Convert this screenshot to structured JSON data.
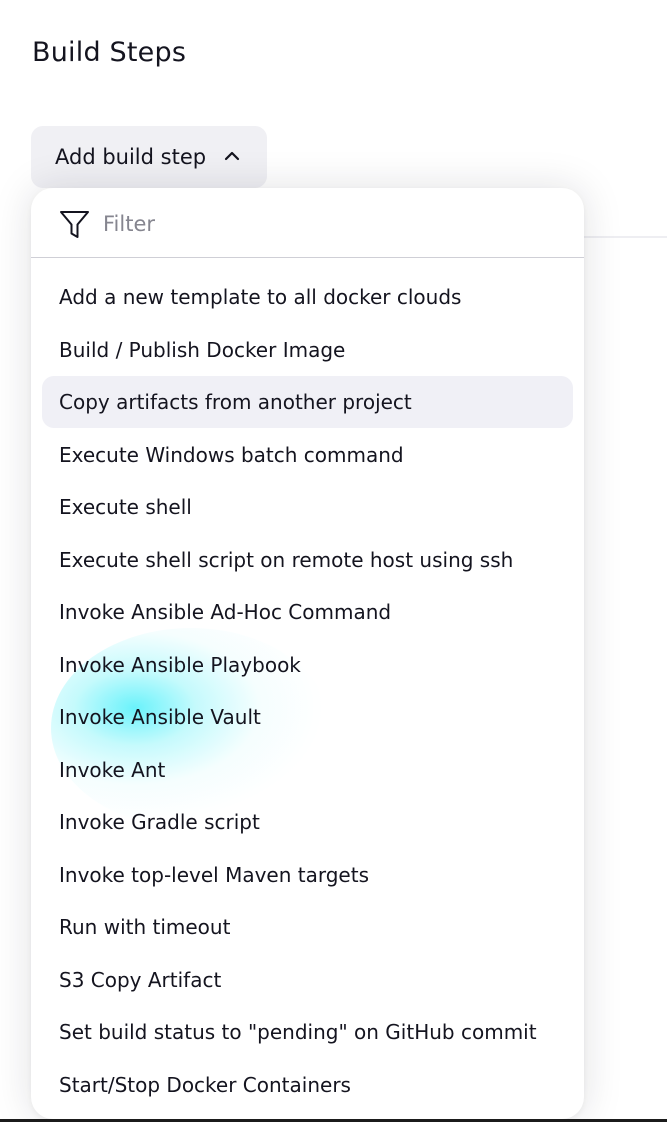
{
  "page": {
    "title": "Build Steps"
  },
  "add_step_button": {
    "label": "Add build step",
    "icon": "chevron-up-icon"
  },
  "dropdown": {
    "filter": {
      "placeholder": "Filter",
      "value": "",
      "icon": "filter-icon"
    },
    "items": [
      {
        "label": "Add a new template to all docker clouds"
      },
      {
        "label": "Build / Publish Docker Image"
      },
      {
        "label": "Copy artifacts from another project",
        "highlighted": true
      },
      {
        "label": "Execute Windows batch command"
      },
      {
        "label": "Execute shell"
      },
      {
        "label": "Execute shell script on remote host using ssh"
      },
      {
        "label": "Invoke Ansible Ad-Hoc Command"
      },
      {
        "label": "Invoke Ansible Playbook"
      },
      {
        "label": "Invoke Ansible Vault"
      },
      {
        "label": "Invoke Ant"
      },
      {
        "label": "Invoke Gradle script"
      },
      {
        "label": "Invoke top-level Maven targets"
      },
      {
        "label": "Run with timeout"
      },
      {
        "label": "S3 Copy Artifact"
      },
      {
        "label": "Set build status to \"pending\" on GitHub commit"
      },
      {
        "label": "Start/Stop Docker Containers"
      }
    ]
  },
  "colors": {
    "item_highlight": "#f0f0f6",
    "button_background": "#f0f0f4",
    "cursor_glow": "#50f0fa"
  }
}
